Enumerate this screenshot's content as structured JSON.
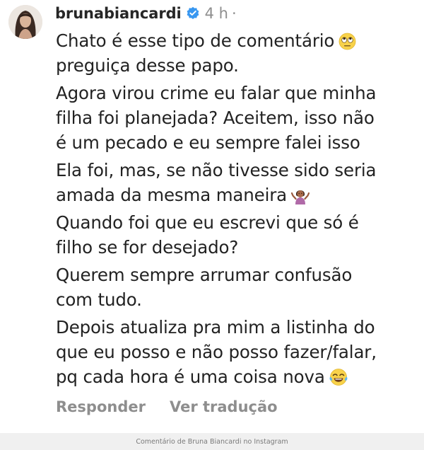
{
  "comment": {
    "username": "brunabiancardi",
    "verified": true,
    "timestamp": "4 h",
    "separator": "·",
    "paragraphs": [
      {
        "lines": [
          "Chato é esse tipo de comentário",
          "preguiça desse papo."
        ],
        "emoji_after_line": 0,
        "emoji": "face-with-rolling-eyes"
      },
      {
        "lines": [
          "Agora virou crime eu falar que minha",
          "filha foi planejada? Aceitem, isso não",
          "é um pecado e eu sempre falei isso"
        ]
      },
      {
        "lines": [
          "Ela foi, mas, se não tivesse sido seria",
          "amada da mesma maneira"
        ],
        "emoji_after_line": 1,
        "emoji": "person-shrugging"
      },
      {
        "lines": [
          "Quando foi que eu escrevi que só é",
          "filho se for desejado?"
        ]
      },
      {
        "lines": [
          "Querem sempre arrumar confusão",
          "com tudo."
        ]
      },
      {
        "lines": [
          "Depois atualiza pra mim a listinha do",
          "que eu posso e não posso fazer/falar,",
          "pq cada hora é uma coisa nova"
        ],
        "emoji_after_line": 2,
        "emoji": "face-with-tears-of-joy"
      }
    ],
    "actions": {
      "reply": "Responder",
      "translate": "Ver tradução"
    }
  },
  "caption": "Comentário de Bruna Biancardi no Instagram",
  "colors": {
    "verified_badge": "#3897f0",
    "muted_text": "#8e8e8e",
    "username": "#262626",
    "body_text": "#222222",
    "caption_bar": "#f0f0f0"
  }
}
